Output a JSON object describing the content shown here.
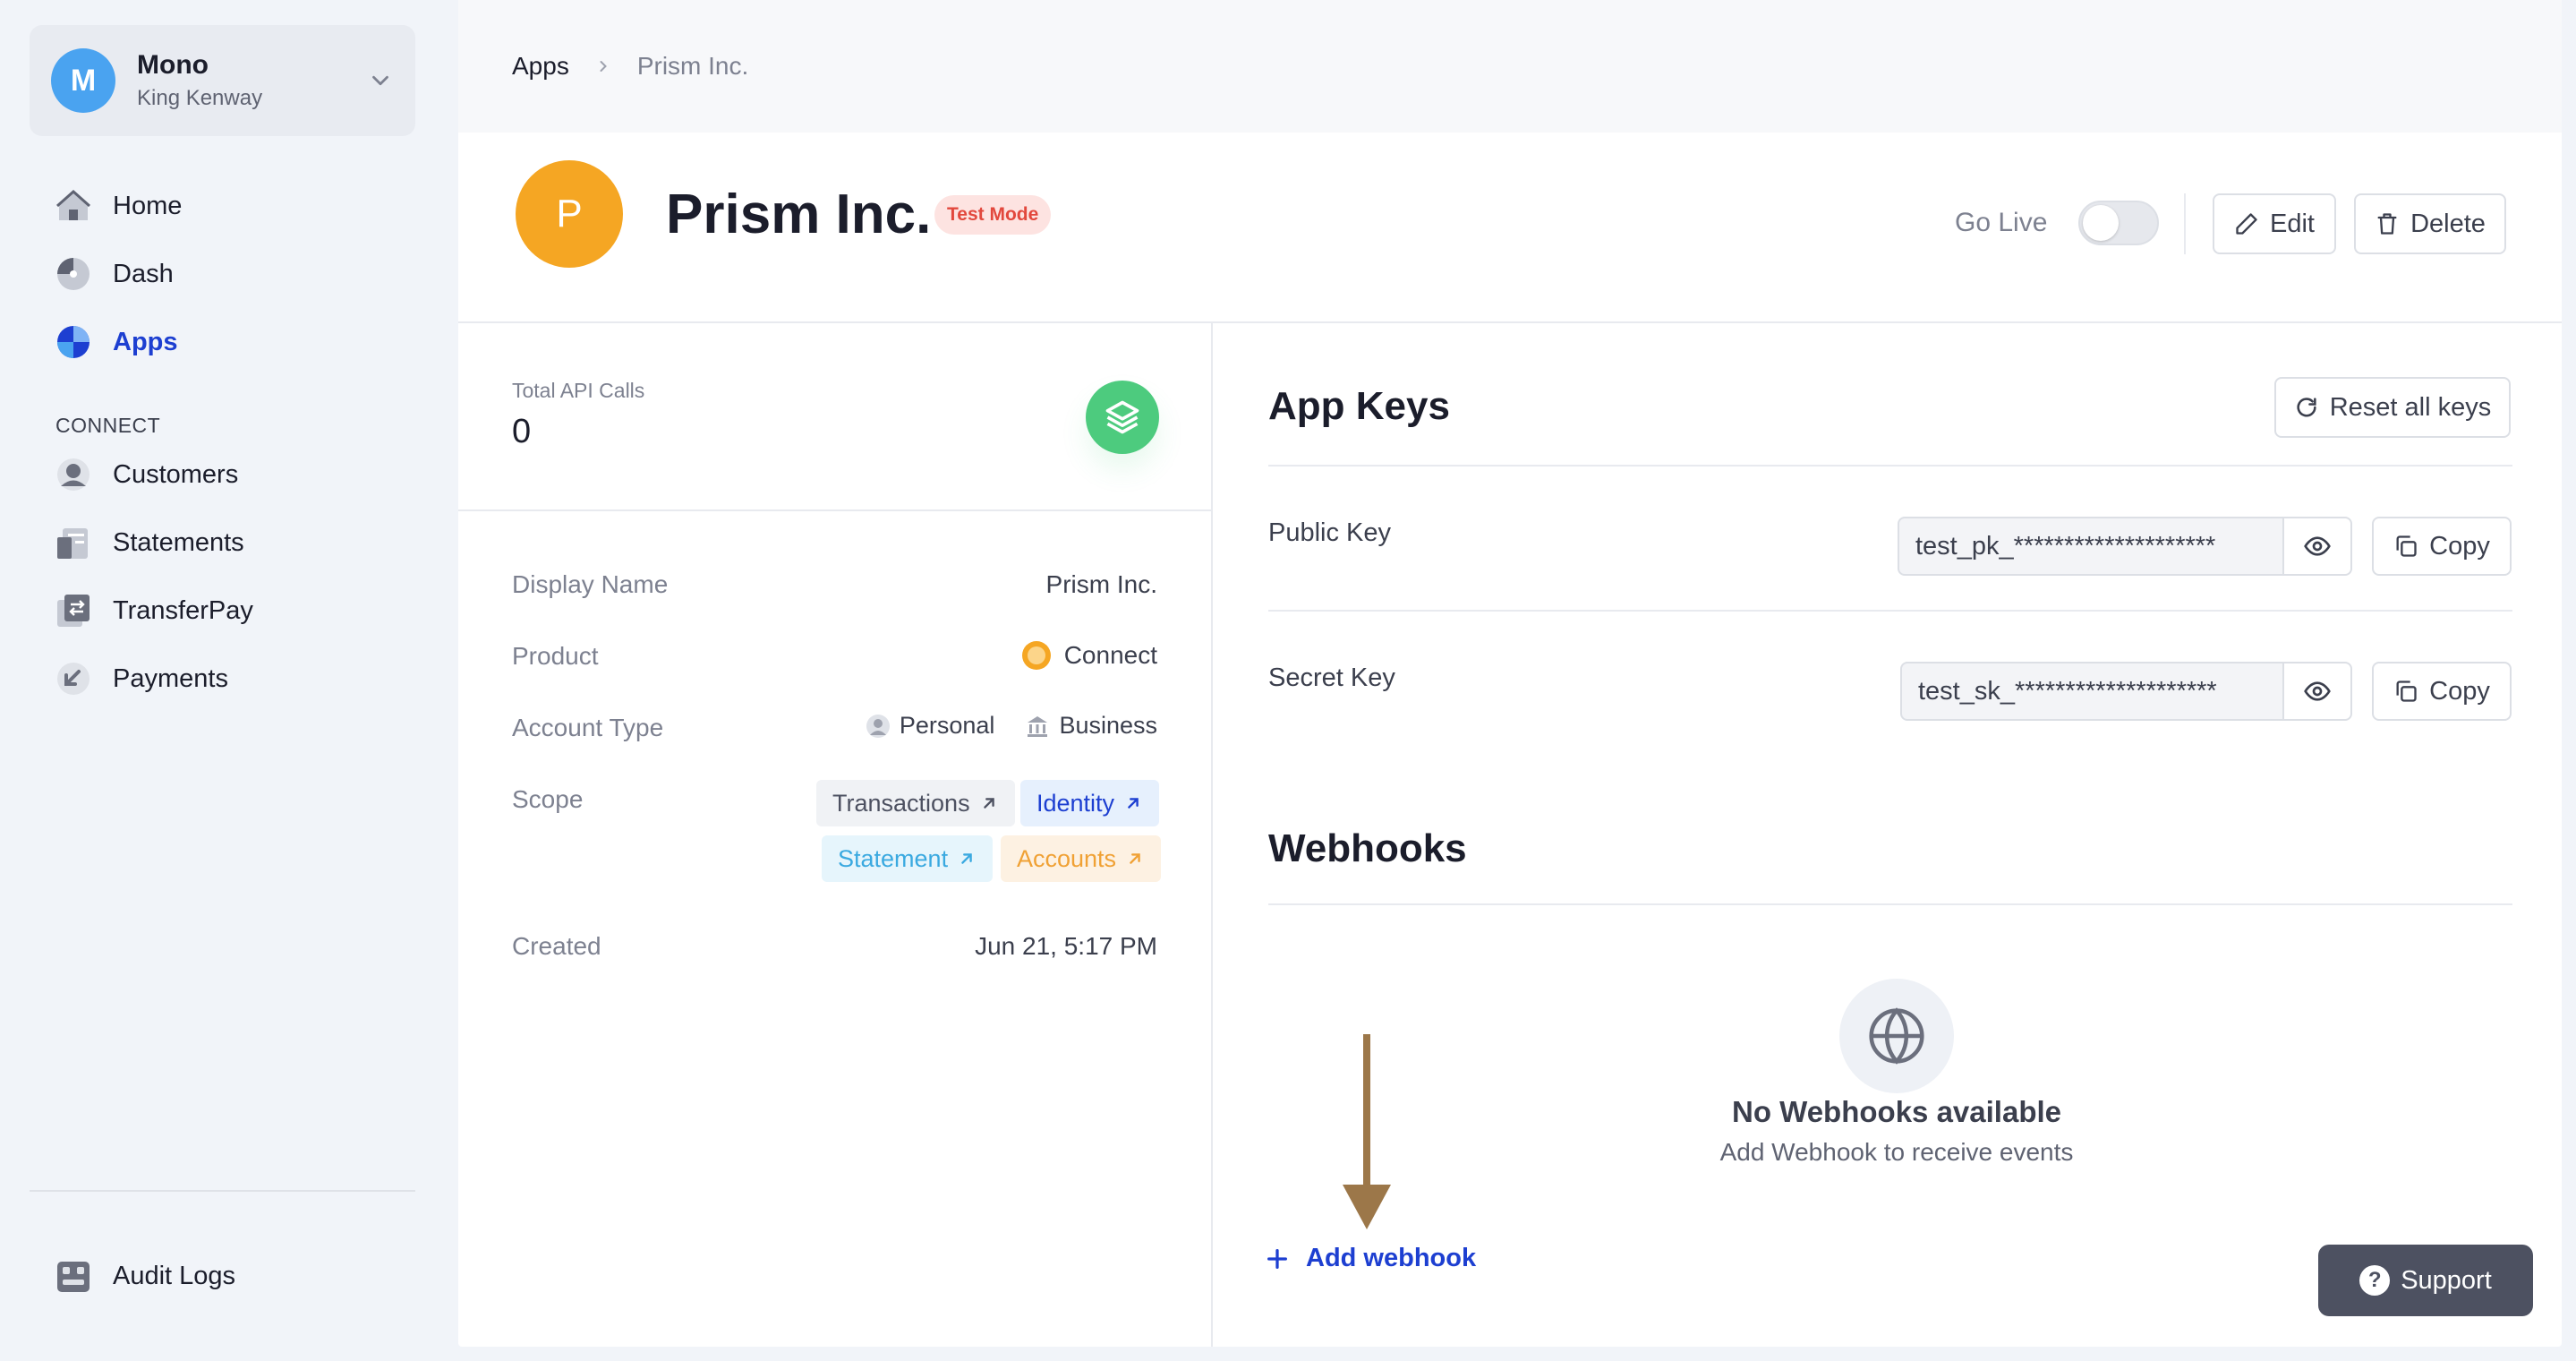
{
  "workspace": {
    "initial": "M",
    "name": "Mono",
    "user": "King Kenway"
  },
  "sidebar": {
    "items": [
      {
        "label": "Home",
        "icon": "home-icon"
      },
      {
        "label": "Dash",
        "icon": "dash-icon"
      },
      {
        "label": "Apps",
        "icon": "apps-icon",
        "active": true
      }
    ],
    "section_label": "CONNECT",
    "connect_items": [
      {
        "label": "Customers",
        "icon": "customers-icon"
      },
      {
        "label": "Statements",
        "icon": "statements-icon"
      },
      {
        "label": "TransferPay",
        "icon": "transferpay-icon"
      },
      {
        "label": "Payments",
        "icon": "payments-icon"
      }
    ],
    "footer_item": {
      "label": "Audit Logs",
      "icon": "audit-logs-icon"
    }
  },
  "breadcrumb": {
    "root": "Apps",
    "current": "Prism Inc."
  },
  "app": {
    "initial": "P",
    "name": "Prism Inc.",
    "mode_badge": "Test Mode",
    "go_live_label": "Go Live",
    "go_live_enabled": false,
    "edit_label": "Edit",
    "delete_label": "Delete"
  },
  "stats": {
    "total_api_calls_label": "Total API Calls",
    "total_api_calls_value": "0"
  },
  "details": {
    "display_name_label": "Display Name",
    "display_name_value": "Prism Inc.",
    "product_label": "Product",
    "product_value": "Connect",
    "account_type_label": "Account Type",
    "account_types": [
      "Personal",
      "Business"
    ],
    "scope_label": "Scope",
    "scopes": [
      {
        "label": "Transactions",
        "color": "#4d5161",
        "bg": "#f0f2f5"
      },
      {
        "label": "Identity",
        "color": "#1d3fd1",
        "bg": "#e6f0fd"
      },
      {
        "label": "Statement",
        "color": "#3aa9e0",
        "bg": "#e6f5fc"
      },
      {
        "label": "Accounts",
        "color": "#f0a134",
        "bg": "#fdf1e2"
      }
    ],
    "created_label": "Created",
    "created_value": "Jun 21, 5:17 PM"
  },
  "app_keys": {
    "title": "App Keys",
    "reset_label": "Reset all keys",
    "public_key_label": "Public Key",
    "public_key_value": "test_pk_********************",
    "secret_key_label": "Secret Key",
    "secret_key_value": "test_sk_********************",
    "copy_label": "Copy"
  },
  "webhooks": {
    "title": "Webhooks",
    "empty_title": "No Webhooks available",
    "empty_subtitle": "Add Webhook to receive events",
    "add_label": "Add webhook"
  },
  "support_label": "Support",
  "colors": {
    "accent": "#1d3fd1",
    "test_badge": "#e2483d",
    "api_icon": "#4dcb7e",
    "arrow": "#9c7749"
  }
}
